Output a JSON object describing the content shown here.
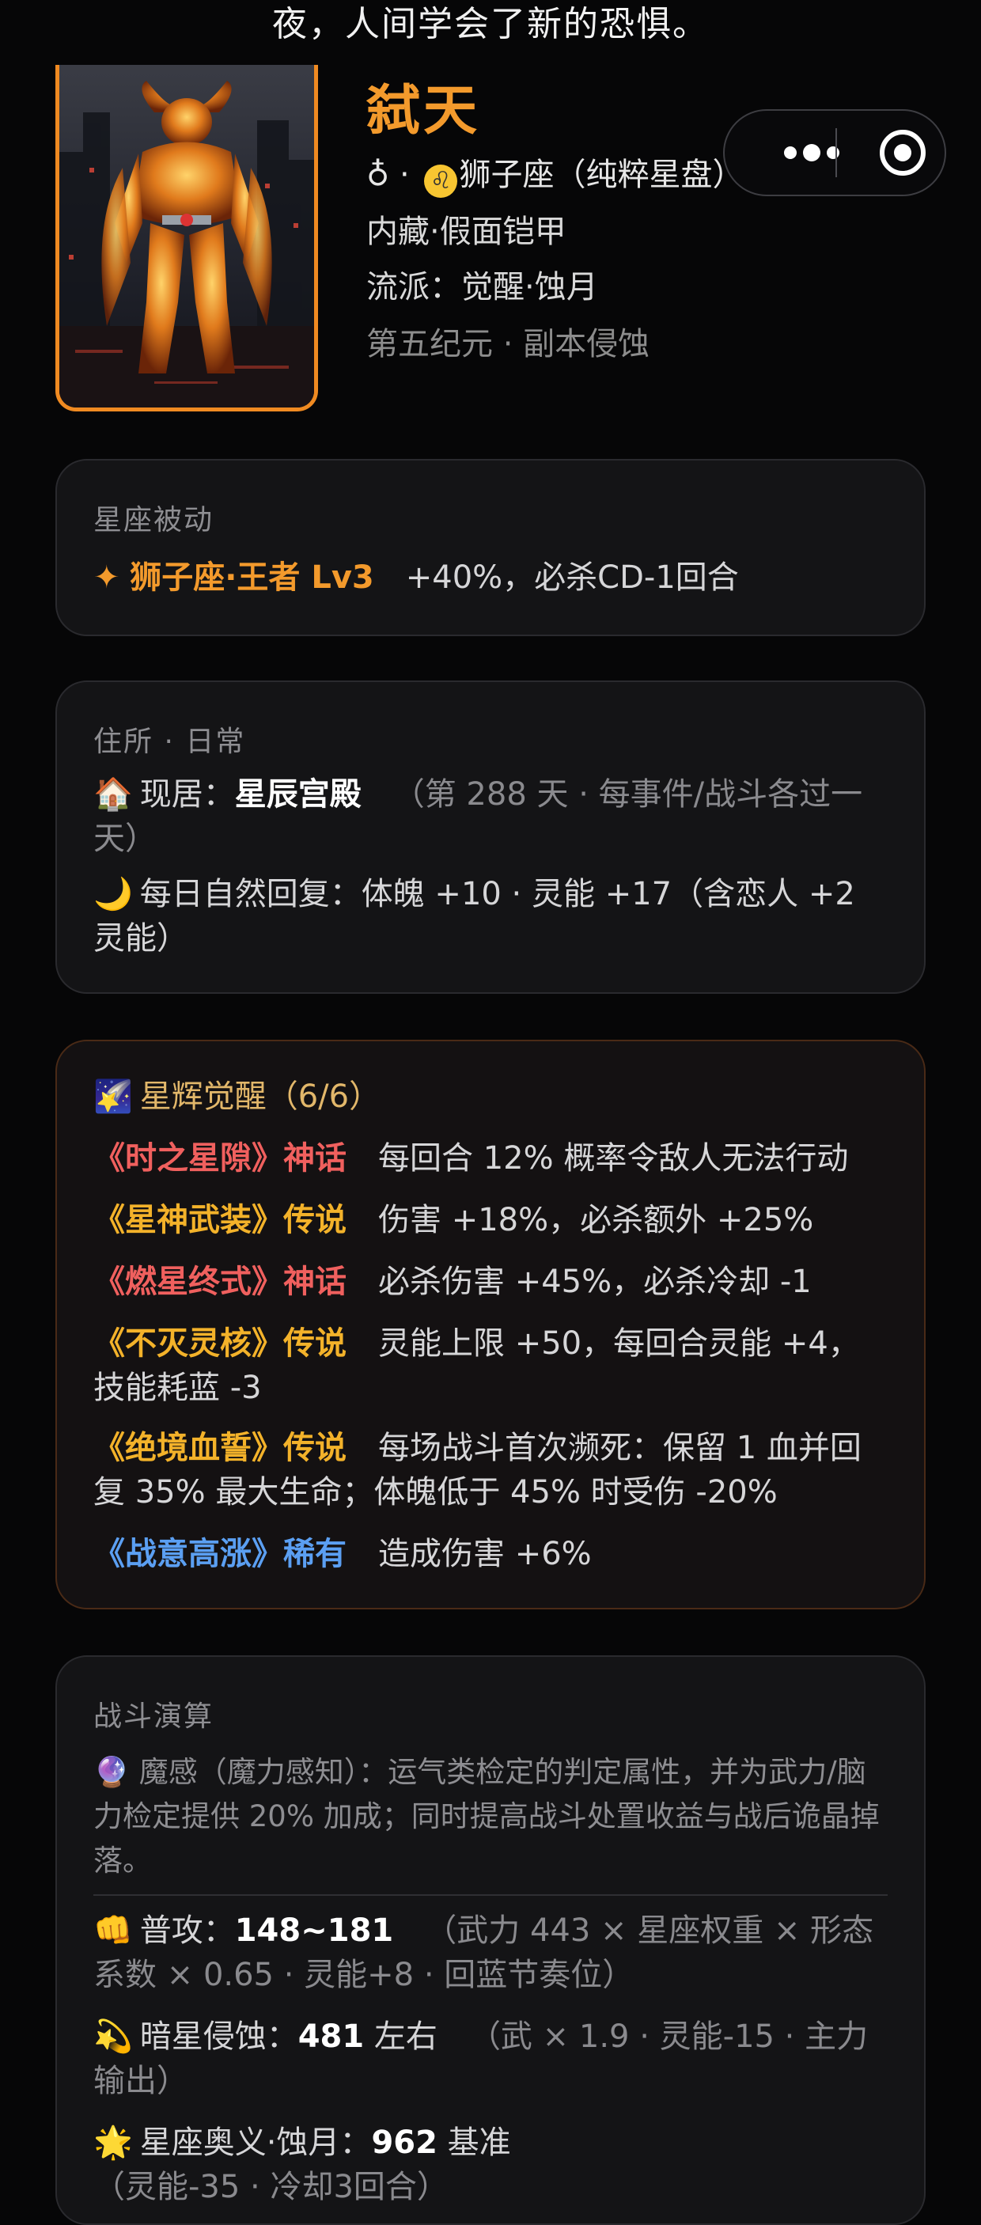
{
  "top_text": "夜，人间学会了新的恐惧。",
  "profile": {
    "name": "弑天",
    "gender_symbol": "♁",
    "sep1": " · ",
    "zodiac_icon": "♌",
    "zodiac": "狮子座（纯粹星盘）",
    "line2": "内藏·假面铠甲",
    "line3": "流派：觉醒·蚀月",
    "line4": "第五纪元 · 副本侵蚀"
  },
  "mini_program_capsule": {
    "more_icon": "more-dots-icon",
    "close_icon": "target-circle-icon"
  },
  "zodiac_passive": {
    "title": "星座被动",
    "star": "✦",
    "name": "狮子座·王者 Lv3",
    "effect": "+40%，必杀CD-1回合"
  },
  "residence": {
    "title": "住所 · 日常",
    "home_icon": "🏠",
    "home_label": "现居：",
    "home_name": "星辰宫殿",
    "home_note": "（第 288 天 · 每事件/战斗各过一天）",
    "moon_icon": "🌙",
    "recover": "每日自然回复：体魄 +10 · 灵能 +17（含恋人 +2 灵能）"
  },
  "awakening": {
    "icon": "🌠",
    "title": "星辉觉醒（6/6）",
    "items": [
      {
        "name": "《时之星隙》神话",
        "rarity": "red",
        "effect": "每回合 12% 概率令敌人无法行动"
      },
      {
        "name": "《星神武装》传说",
        "rarity": "gold",
        "effect": "伤害 +18%，必杀额外 +25%"
      },
      {
        "name": "《燃星终式》神话",
        "rarity": "red",
        "effect": "必杀伤害 +45%，必杀冷却 -1"
      },
      {
        "name": "《不灭灵核》传说",
        "rarity": "gold",
        "effect": "灵能上限 +50，每回合灵能 +4，技能耗蓝 -3"
      },
      {
        "name": "《绝境血誓》传说",
        "rarity": "gold",
        "effect": "每场战斗首次濒死：保留 1 血并回复 35% 最大生命；体魄低于 45% 时受伤 -20%"
      },
      {
        "name": "《战意高涨》稀有",
        "rarity": "blue",
        "effect": "造成伤害 +6%"
      }
    ]
  },
  "combat": {
    "title": "战斗演算",
    "orb_icon": "🔮",
    "magic_note": "魔感（魔力感知）：运气类检定的判定属性，并为武力/脑力检定提供 20% 加成；同时提高战斗处置收益与战后诡晶掉落。",
    "attack_icon": "👊",
    "attack_label": "普攻：",
    "attack_value": "148~181",
    "attack_note": "（武力 443 × 星座权重 × 形态系数 × 0.65 · 灵能+8 · 回蓝节奏位）",
    "skill_icon": "💫",
    "skill_label": "暗星侵蚀：",
    "skill_value": "481",
    "skill_suffix": " 左右",
    "skill_note": "（武 × 1.9 · 灵能-15 · 主力输出）",
    "ult_icon": "🌟",
    "ult_label": "星座奥义·蚀月：",
    "ult_value": "962",
    "ult_suffix": " 基准",
    "ult_note": "（灵能-35 · 冷却3回合）"
  }
}
